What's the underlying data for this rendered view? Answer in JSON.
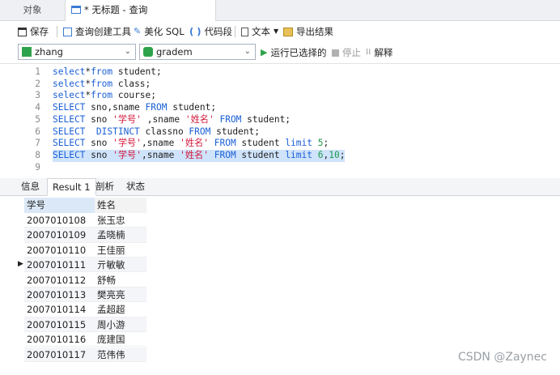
{
  "tabs": {
    "objects": "对象",
    "query": "* 无标题 - 查询"
  },
  "toolbar": {
    "save": "保存",
    "query_builder": "查询创建工具",
    "beautify_sql": "美化 SQL",
    "code_snippet": "代码段",
    "text": "文本",
    "export_result": "导出结果"
  },
  "selectors": {
    "connection": "zhang",
    "database": "gradem",
    "run_selected": "运行已选择的",
    "stop": "停止",
    "explain": "解释"
  },
  "editor": {
    "line_numbers": [
      "1",
      "2",
      "3",
      "4",
      "5",
      "6",
      "7",
      "8",
      "9"
    ],
    "selected_line": 8
  },
  "result_tabs": [
    "信息",
    "Result 1",
    "剖析",
    "状态"
  ],
  "grid": {
    "headers": [
      "学号",
      "姓名"
    ],
    "rows": [
      [
        "2007010108",
        "张玉忠"
      ],
      [
        "2007010109",
        "孟晓楠"
      ],
      [
        "2007010110",
        "王佳丽"
      ],
      [
        "2007010111",
        "亓敏敏"
      ],
      [
        "2007010112",
        "舒畅"
      ],
      [
        "2007010113",
        "樊亮亮"
      ],
      [
        "2007010114",
        "孟超超"
      ],
      [
        "2007010115",
        "周小游"
      ],
      [
        "2007010116",
        "庞建国"
      ],
      [
        "2007010117",
        "范伟伟"
      ]
    ],
    "current_row_marker": "▶"
  },
  "watermark": "CSDN @Zaynec",
  "colors": {
    "keyword": "#1a5fd6",
    "string": "#d2173a",
    "number": "#1a9a4a",
    "selection": "#cfe3fb"
  }
}
